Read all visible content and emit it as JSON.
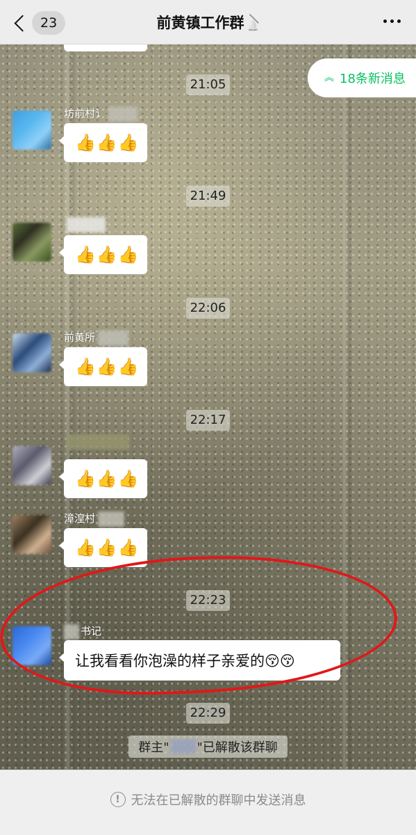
{
  "header": {
    "unread_count": "23",
    "title": "前黄镇工作群",
    "muted": true
  },
  "new_messages_pill": {
    "label": "18条新消息",
    "arrow_icon": "double-chevron-up-icon"
  },
  "messages": [
    {
      "time": "21:05",
      "sender": "坊前村讠",
      "content": "👍👍👍"
    },
    {
      "time": "21:49",
      "sender": "",
      "content": "👍👍👍"
    },
    {
      "time": "22:06",
      "sender": "前黄所",
      "content": "👍👍👍"
    },
    {
      "time": "22:17",
      "sender": "",
      "content": "👍👍👍"
    },
    {
      "time": "",
      "sender": "漳湟村",
      "content": "👍👍👍"
    },
    {
      "time": "22:23",
      "sender": "书记",
      "content": "让我看看你泡澡的样子亲爱的😚😚"
    }
  ],
  "system": {
    "time": "22:29",
    "prefix": "群主\"",
    "suffix": "\"已解散该群聊"
  },
  "footer": {
    "notice": "无法在已解散的群聊中发送消息",
    "icon": "info-circle-icon"
  },
  "colors": {
    "accent": "#07c160",
    "annotation": "#e01818",
    "bubble": "#ffffff"
  }
}
